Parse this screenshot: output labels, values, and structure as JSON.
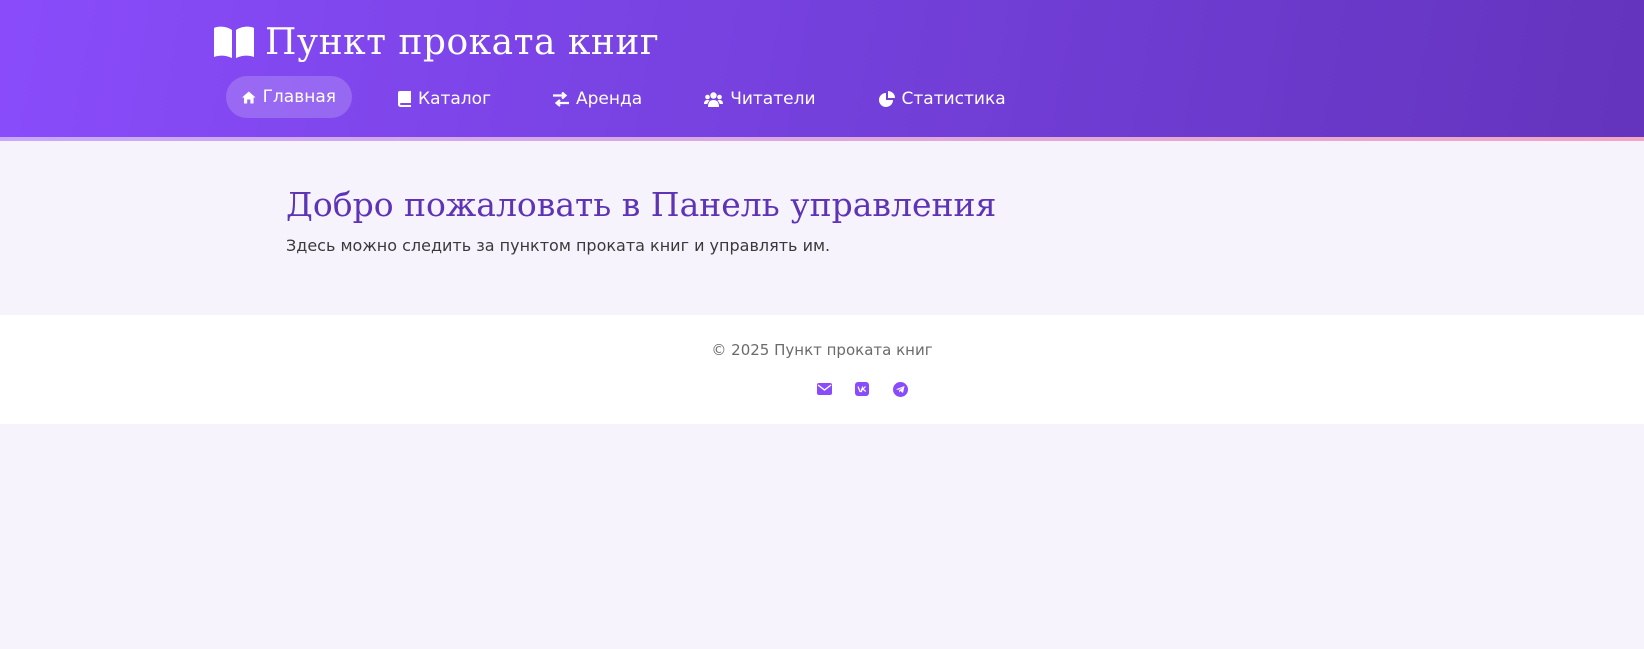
{
  "header": {
    "brand_title": "Пункт проката книг",
    "brand_icon": "open-book-icon"
  },
  "nav": {
    "items": [
      {
        "label": "Главная",
        "icon": "home-icon",
        "active": true
      },
      {
        "label": "Каталог",
        "icon": "book-icon",
        "active": false
      },
      {
        "label": "Аренда",
        "icon": "exchange-arrows-icon",
        "active": false
      },
      {
        "label": "Читатели",
        "icon": "users-icon",
        "active": false
      },
      {
        "label": "Статистика",
        "icon": "pie-chart-icon",
        "active": false
      }
    ]
  },
  "main": {
    "title": "Добро пожаловать в Панель управления",
    "subtitle": "Здесь можно следить за пунктом проката книг и управлять им."
  },
  "footer": {
    "copyright": "© 2025 Пункт проката книг",
    "social": [
      {
        "icon": "email-icon"
      },
      {
        "icon": "vk-icon"
      },
      {
        "icon": "telegram-icon"
      }
    ]
  },
  "colors": {
    "header_gradient_start": "#8a4cfb",
    "header_gradient_end": "#6434bd",
    "accent": "#8a4cfb",
    "title": "#5e34b6",
    "page_background": "#f6f3fc",
    "footer_background": "#ffffff"
  }
}
